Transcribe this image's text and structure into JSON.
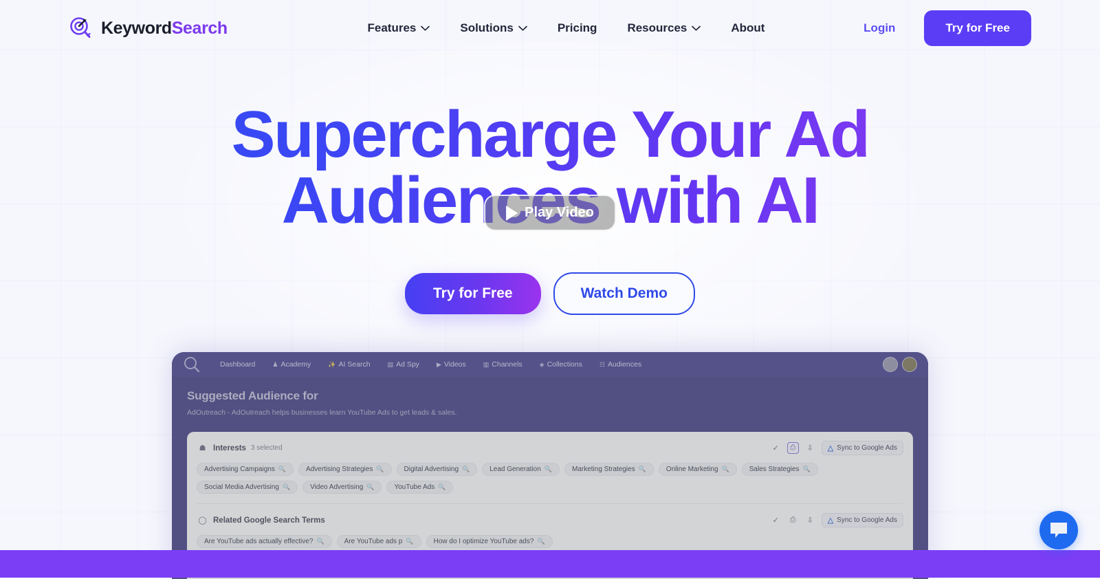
{
  "brand": {
    "logo_icon": "target-magnifier-icon",
    "name_part1": "Keyword",
    "name_part2": "Search"
  },
  "nav": {
    "items": [
      {
        "label": "Features",
        "has_dropdown": true
      },
      {
        "label": "Solutions",
        "has_dropdown": true
      },
      {
        "label": "Pricing",
        "has_dropdown": false
      },
      {
        "label": "Resources",
        "has_dropdown": true
      },
      {
        "label": "About",
        "has_dropdown": false
      }
    ],
    "login_label": "Login",
    "cta_label": "Try for Free"
  },
  "hero": {
    "title_line1": "Supercharge Your Ad",
    "title_line2": "Audiences with AI",
    "primary_cta": "Try for Free",
    "secondary_cta": "Watch Demo",
    "gradient_start": "#2f4ff5",
    "gradient_end": "#9b3df0"
  },
  "app_preview": {
    "nav_items": [
      {
        "label": "Dashboard",
        "icon": ""
      },
      {
        "label": "Academy",
        "icon": "♟"
      },
      {
        "label": "AI Search",
        "icon": "✨"
      },
      {
        "label": "Ad Spy",
        "icon": "▤"
      },
      {
        "label": "Videos",
        "icon": "▶"
      },
      {
        "label": "Channels",
        "icon": "▥"
      },
      {
        "label": "Collections",
        "icon": "◈"
      },
      {
        "label": "Audiences",
        "icon": "☷"
      }
    ],
    "heading": "Suggested Audience for",
    "subheading": "AdOutreach - AdOutreach helps businesses learn YouTube Ads to get leads & sales.",
    "interests": {
      "title": "Interests",
      "icon": "lightbulb-icon",
      "count_label": "3 selected",
      "sync_label": "Sync to Google Ads",
      "actions": [
        "check-icon",
        "copy-icon",
        "download-icon"
      ],
      "tags": [
        "Advertising Campaigns",
        "Advertising Strategies",
        "Digital Advertising",
        "Lead Generation",
        "Marketing Strategies",
        "Online Marketing",
        "Sales Strategies",
        "Social Media Advertising",
        "Video Advertising",
        "YouTube Ads"
      ]
    },
    "search_terms": {
      "title": "Related Google Search Terms",
      "icon": "search-icon",
      "sync_label": "Sync to Google Ads",
      "actions": [
        "check-icon",
        "copy-icon",
        "download-icon"
      ],
      "tags": [
        "Are YouTube ads actually effective?",
        "Are YouTube ads p",
        "How do I optimize YouTube ads?"
      ]
    },
    "play_button_label": "Play Video"
  },
  "chat": {
    "icon": "chat-bubble-icon",
    "color": "#1f6bf0"
  },
  "bottom_bar": {
    "color": "#7b3ef5"
  }
}
